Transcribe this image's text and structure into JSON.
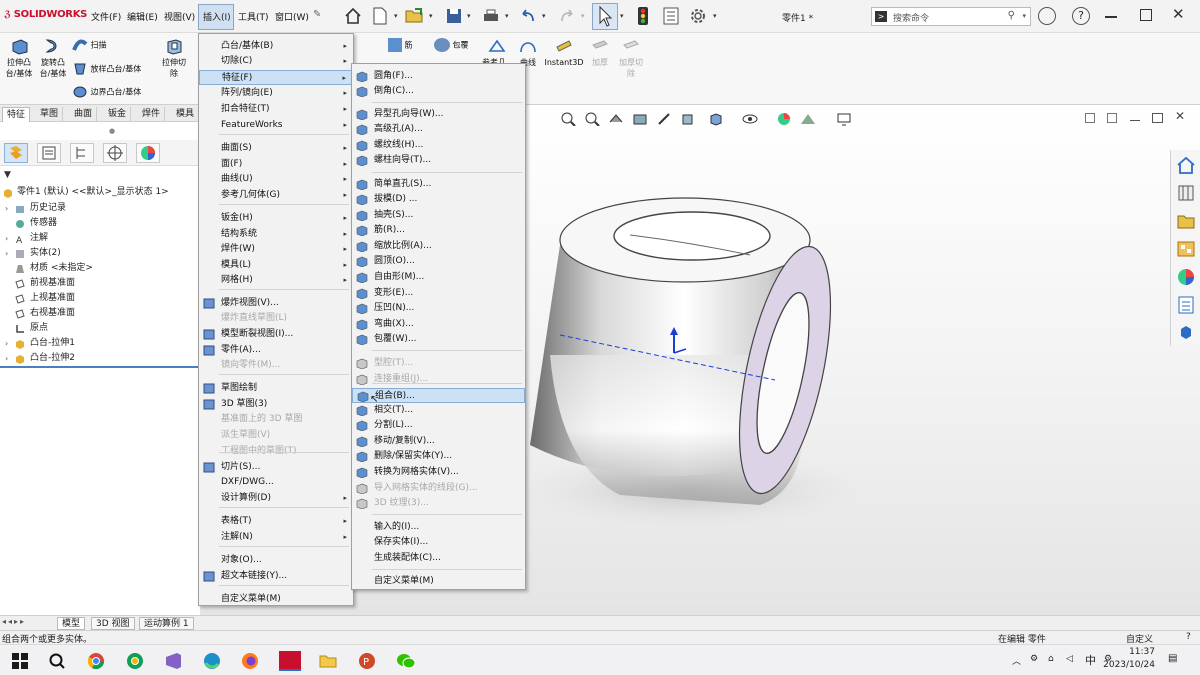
{
  "app": {
    "logo_text": "SOLIDWORKS",
    "document_title": "零件1 *"
  },
  "menubar": [
    "文件(F)",
    "编辑(E)",
    "视图(V)",
    "插入(I)",
    "工具(T)",
    "窗口(W)"
  ],
  "search": {
    "placeholder": "搜索命令"
  },
  "command_manager": {
    "items": [
      "拉伸凸台/基体",
      "旋转凸台/基体",
      "扫描",
      "放样凸台/基体",
      "边界凸台/基体",
      "拉伸切除",
      "筋",
      "包覆",
      "参考几...",
      "曲线",
      "Instant3D",
      "加厚",
      "加厚切除"
    ]
  },
  "feature_tabs": [
    "特征",
    "草图",
    "曲面",
    "钣金",
    "焊件",
    "模具"
  ],
  "tree": {
    "root": "零件1 (默认) <<默认>_显示状态 1>",
    "items": [
      "历史记录",
      "传感器",
      "注解",
      "实体(2)",
      "材质 <未指定>",
      "前视基准面",
      "上视基准面",
      "右视基准面",
      "原点",
      "凸台-拉伸1",
      "凸台-拉伸2"
    ]
  },
  "insert_menu": [
    "凸台/基体(B)",
    "切除(C)",
    "特征(F)",
    "阵列/镜向(E)",
    "扣合特征(T)",
    "FeatureWorks",
    "曲面(S)",
    "面(F)",
    "曲线(U)",
    "参考几何体(G)",
    "钣金(H)",
    "结构系统",
    "焊件(W)",
    "模具(L)",
    "网格(H)",
    "爆炸视图(V)...",
    "爆炸直线草图(L)",
    "模型断裂视图(I)...",
    "零件(A)...",
    "镜向零件(M)...",
    "草图绘制",
    "3D 草图(3)",
    "基准面上的 3D 草图",
    "派生草图(V)",
    "工程图中的草图(T)",
    "切片(S)...",
    "DXF/DWG...",
    "设计算例(D)",
    "表格(T)",
    "注解(N)",
    "对象(O)...",
    "超文本链接(Y)...",
    "自定义菜单(M)"
  ],
  "features_submenu": [
    "圆角(F)...",
    "倒角(C)...",
    "异型孔向导(W)...",
    "高级孔(A)...",
    "螺纹线(H)...",
    "螺柱向导(T)...",
    "简单直孔(S)...",
    "拔模(D) ...",
    "抽壳(S)...",
    "筋(R)...",
    "缩放比例(A)...",
    "圆顶(O)...",
    "自由形(M)...",
    "变形(E)...",
    "压凹(N)...",
    "弯曲(X)...",
    "包覆(W)...",
    "型腔(T)...",
    "连接重组(J)...",
    "组合(B)...",
    "相交(T)...",
    "分割(L)...",
    "移动/复制(V)...",
    "删除/保留实体(Y)...",
    "转换为网格实体(V)...",
    "导入网格实体的线段(G)...",
    "3D 纹理(3)...",
    "输入的(I)...",
    "保存实体(I)...",
    "生成装配体(C)...",
    "自定义菜单(M)"
  ],
  "model_tabs": [
    "模型",
    "3D 视图",
    "运动算例 1"
  ],
  "status": {
    "left": "组合两个或更多实体。",
    "mode": "在编辑 零件",
    "custom": "自定义"
  },
  "taskbar": {
    "ime": "中",
    "time": "11:37",
    "date": "2023/10/24"
  },
  "colors": {
    "accent": "#2b6cc4",
    "highlight": "#cde1f5",
    "solidworks_red": "#c8102e"
  }
}
